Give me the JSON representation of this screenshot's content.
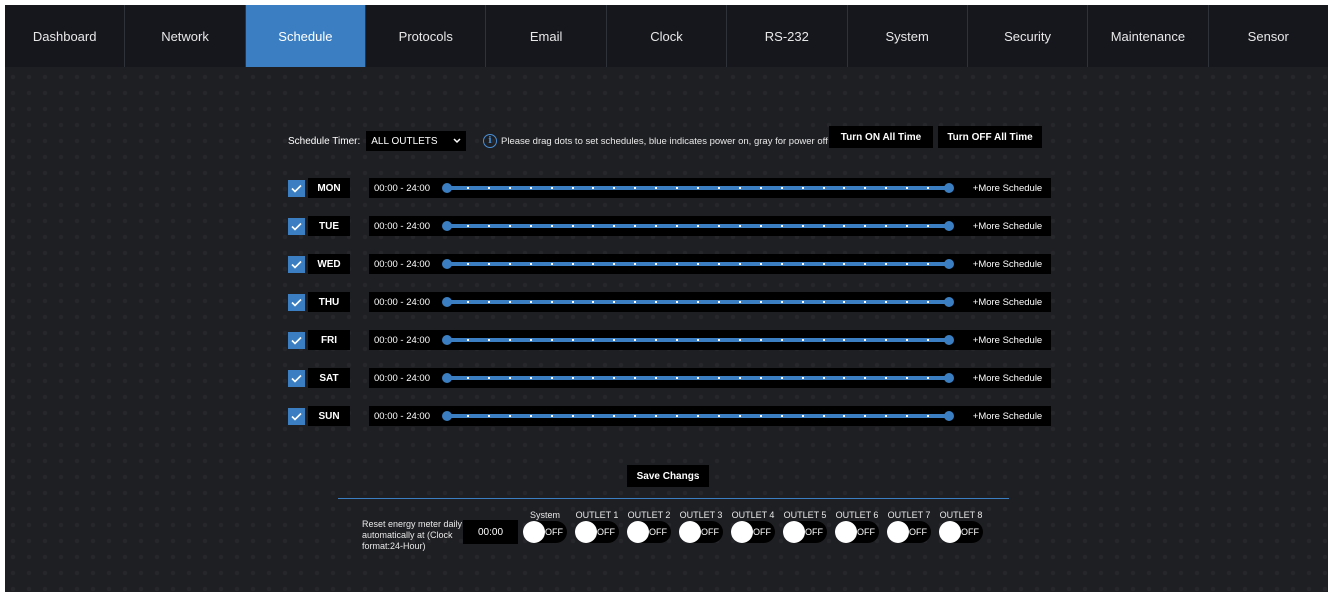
{
  "nav": {
    "tabs": [
      {
        "label": "Dashboard",
        "active": false
      },
      {
        "label": "Network",
        "active": false
      },
      {
        "label": "Schedule",
        "active": true
      },
      {
        "label": "Protocols",
        "active": false
      },
      {
        "label": "Email",
        "active": false
      },
      {
        "label": "Clock",
        "active": false
      },
      {
        "label": "RS-232",
        "active": false
      },
      {
        "label": "System",
        "active": false
      },
      {
        "label": "Security",
        "active": false
      },
      {
        "label": "Maintenance",
        "active": false
      },
      {
        "label": "Sensor",
        "active": false
      }
    ]
  },
  "schedule": {
    "timer_label": "Schedule Timer:",
    "timer_value": "ALL OUTLETS",
    "info_text": "Please drag dots to set schedules, blue indicates power on, gray for power off",
    "turn_on_label": "Turn ON All Time",
    "turn_off_label": "Turn OFF All Time",
    "days": [
      {
        "day": "MON",
        "range": "00:00 - 24:00",
        "checked": true,
        "more": "+More Schedule"
      },
      {
        "day": "TUE",
        "range": "00:00 - 24:00",
        "checked": true,
        "more": "+More Schedule"
      },
      {
        "day": "WED",
        "range": "00:00 - 24:00",
        "checked": true,
        "more": "+More Schedule"
      },
      {
        "day": "THU",
        "range": "00:00 - 24:00",
        "checked": true,
        "more": "+More Schedule"
      },
      {
        "day": "FRI",
        "range": "00:00 - 24:00",
        "checked": true,
        "more": "+More Schedule"
      },
      {
        "day": "SAT",
        "range": "00:00 - 24:00",
        "checked": true,
        "more": "+More Schedule"
      },
      {
        "day": "SUN",
        "range": "00:00 - 24:00",
        "checked": true,
        "more": "+More Schedule"
      }
    ],
    "save_label": "Save Changs"
  },
  "energy": {
    "reset_label": "Reset energy meter daily automatically at (Clock format:24-Hour)",
    "reset_time": "00:00",
    "toggles": [
      {
        "label": "System",
        "state": "OFF"
      },
      {
        "label": "OUTLET 1",
        "state": "OFF"
      },
      {
        "label": "OUTLET 2",
        "state": "OFF"
      },
      {
        "label": "OUTLET 3",
        "state": "OFF"
      },
      {
        "label": "OUTLET 4",
        "state": "OFF"
      },
      {
        "label": "OUTLET 5",
        "state": "OFF"
      },
      {
        "label": "OUTLET 6",
        "state": "OFF"
      },
      {
        "label": "OUTLET 7",
        "state": "OFF"
      },
      {
        "label": "OUTLET 8",
        "state": "OFF"
      }
    ]
  },
  "colors": {
    "accent": "#3b7fc2",
    "background": "#1e1f23",
    "nav_bg": "#16171d"
  }
}
